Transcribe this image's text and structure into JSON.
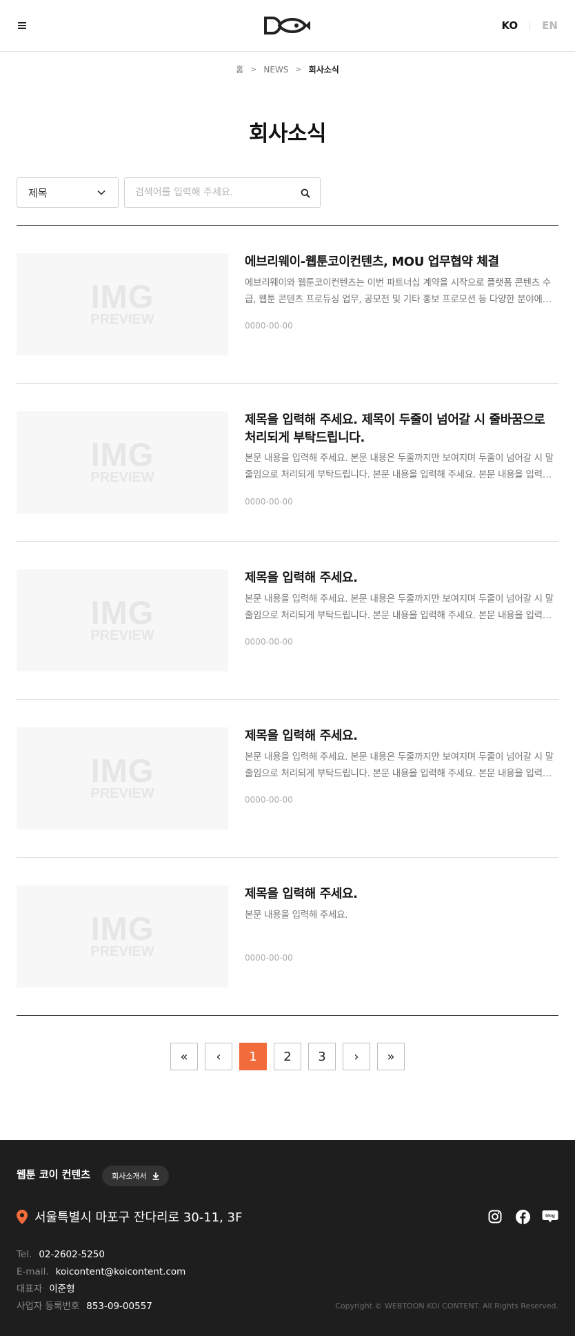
{
  "header": {
    "lang_ko": "KO",
    "lang_en": "EN"
  },
  "breadcrumb": {
    "home": "홈",
    "section": "NEWS",
    "current": "회사소식",
    "sep": ">"
  },
  "page_title": "회사소식",
  "search": {
    "select_value": "제목",
    "placeholder": "검색어를 입력해 주세요."
  },
  "thumb": {
    "big": "IMG",
    "small": "PREVIEW"
  },
  "items": [
    {
      "title": "에브리웨이-웹툰코이컨텐츠,  MOU 업무협약 체결",
      "desc": "에브리웨이와 웹툰코이컨텐츠는 이번 파트너십 계약을 시작으로 플랫폼 콘텐츠 수급, 웹툰 콘텐츠 프로듀싱 업무, 공모전 및 기타 홍보 프로모션 등 다양한 분야에서 협력할 예정입니다.",
      "date": "0000-00-00"
    },
    {
      "title": "제목을 입력해 주세요. 제목이 두줄이 넘어갈 시 줄바꿈으로 처리되게 부탁드립니다.",
      "desc": "본문 내용을 입력해 주세요. 본문 내용은 두줄까지만 보여지며 두줄이 넘어갈 시 말줄임으로 처리되게 부탁드립니다. 본문 내용을 입력해 주세요. 본문 내용을 입력해 주세요.",
      "date": "0000-00-00"
    },
    {
      "title": "제목을 입력해 주세요.",
      "desc": "본문 내용을 입력해 주세요. 본문 내용은 두줄까지만 보여지며 두줄이 넘어갈 시 말줄임으로 처리되게 부탁드립니다. 본문 내용을 입력해 주세요. 본문 내용을 입력해 주세요.",
      "date": "0000-00-00"
    },
    {
      "title": "제목을 입력해 주세요.",
      "desc": "본문 내용을 입력해 주세요. 본문 내용은 두줄까지만 보여지며 두줄이 넘어갈 시 말줄임으로 처리되게 부탁드립니다. 본문 내용을 입력해 주세요. 본문 내용을 입력해 주세요.",
      "date": "0000-00-00"
    },
    {
      "title": "제목을 입력해 주세요.",
      "desc": "본문 내용을 입력해 주세요.",
      "date": "0000-00-00"
    }
  ],
  "pagination": {
    "first": "«",
    "prev": "‹",
    "pages": [
      "1",
      "2",
      "3"
    ],
    "current": "1",
    "next": "›",
    "last": "»"
  },
  "footer": {
    "company": "웹툰 코이 컨텐츠",
    "brochure": "회사소개서",
    "address": "서울특별시 마포구 잔다리로 30-11, 3F",
    "tel_label": "Tel.",
    "tel": "02-2602-5250",
    "email_label": "E-mail.",
    "email": "koicontent@koicontent.com",
    "ceo_label": "대표자",
    "ceo": "이준형",
    "biz_label": "사업자 등록번호",
    "biz": "853-09-00557",
    "copyright": "Copyright © WEBTOON KOI CONTENT. All Rights Reserved.",
    "blog_label": "blog"
  },
  "colors": {
    "accent": "#f26b3a",
    "footer_bg": "#1e1e1e"
  }
}
